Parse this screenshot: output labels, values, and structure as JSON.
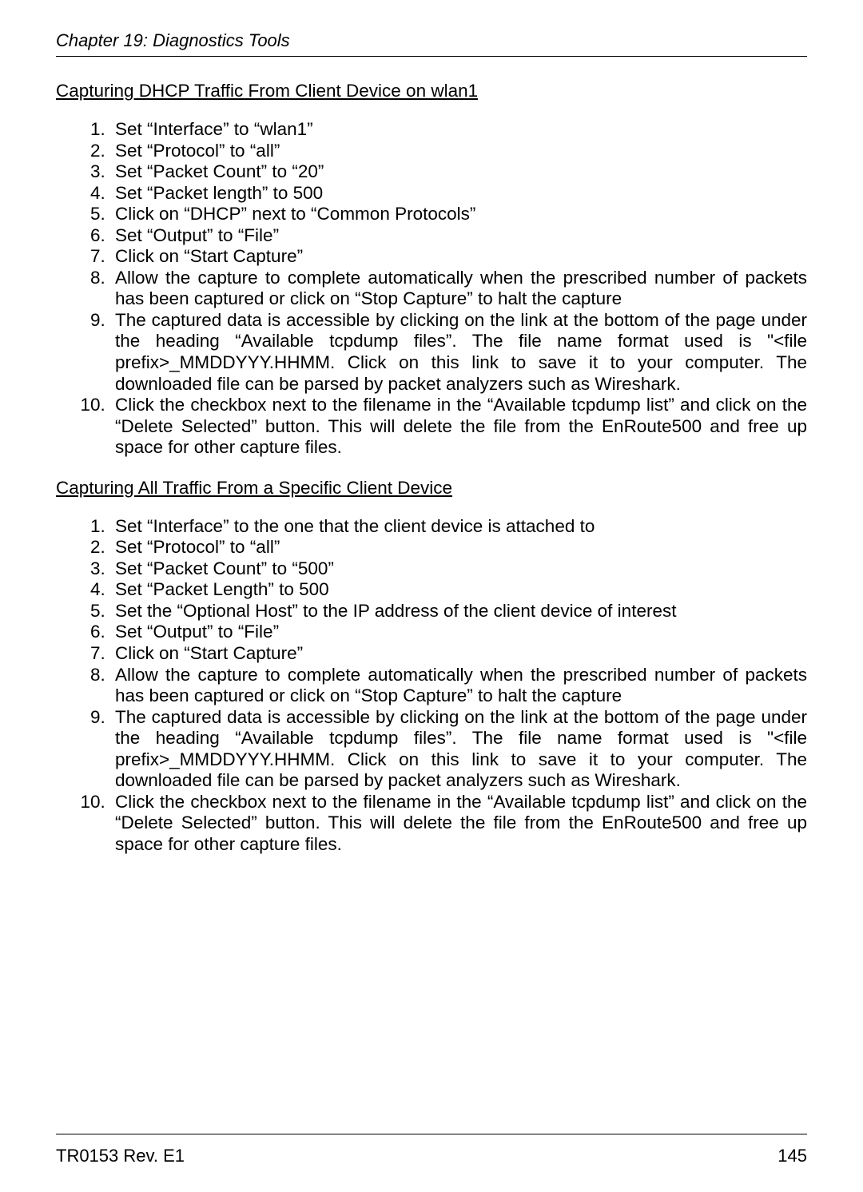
{
  "header": {
    "chapter": "Chapter 19: Diagnostics Tools"
  },
  "sections": [
    {
      "title": "Capturing DHCP Traffic From Client Device on wlan1",
      "steps": [
        "Set \"Interface\" to \"wlan1\"",
        "Set \"Protocol\" to \"all\"",
        "Set \"Packet Count\" to \"20\"",
        "Set \"Packet length\" to 500",
        "Click on \"DHCP\" next to \"Common Protocols\"",
        "Set \"Output\" to \"File\"",
        "Click on \"Start Capture\"",
        "Allow the capture to complete automatically when the prescribed number of packets has been captured or click on \"Stop Capture\" to halt the capture",
        "The captured data is accessible by clicking on the link at the bottom of the page under the heading \"Available tcpdump files\". The file name format used is \"<file prefix>_MMDDYYY.HHMM. Click on this link to save it to your computer. The downloaded file can be parsed by packet analyzers such as Wireshark.",
        "Click the checkbox next to the filename in the \"Available tcpdump list\" and click on the \"Delete Selected\" button. This will delete the file from the EnRoute500 and free up space for other capture files."
      ]
    },
    {
      "title": "Capturing All Traffic From a Specific Client Device",
      "steps": [
        "Set \"Interface\" to the one that the client device is attached to",
        "Set \"Protocol\" to \"all\"",
        "Set \"Packet Count\" to \"500\"",
        "Set \"Packet Length\" to 500",
        "Set the \"Optional Host\" to the IP address of the client device of interest",
        "Set \"Output\" to \"File\"",
        "Click on \"Start Capture\"",
        "Allow the capture to complete automatically when the prescribed number of packets has been captured or click on \"Stop Capture\" to halt the capture",
        "The captured data is accessible by clicking on the link at the bottom of the page under the heading \"Available tcpdump files\". The file name format used is \"<file prefix>_MMDDYYY.HHMM. Click on this link to save it to your computer. The downloaded file can be parsed by packet analyzers such as Wireshark.",
        "Click the checkbox next to the filename in the \"Available tcpdump list\" and click on the \"Delete Selected\" button. This will delete the file from the EnRoute500 and free up space for other capture files."
      ]
    }
  ],
  "footer": {
    "doc_id": "TR0153 Rev. E1",
    "page_number": "145"
  }
}
